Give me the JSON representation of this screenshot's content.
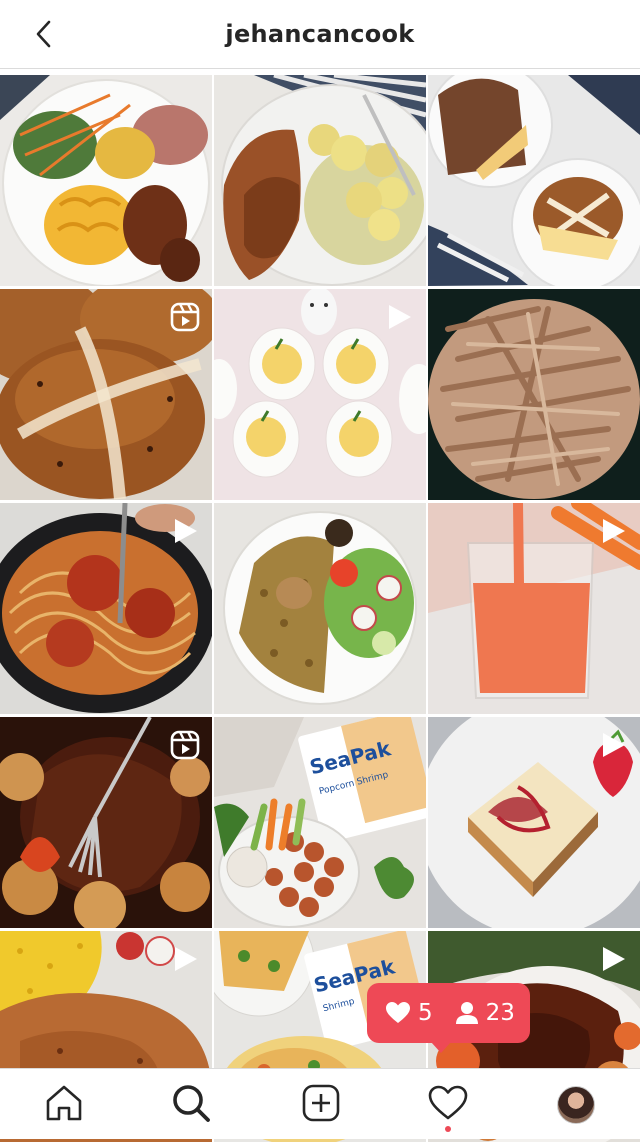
{
  "header": {
    "username": "jehancancook",
    "back_icon": "chevron-left-icon"
  },
  "grid": {
    "tiles": [
      {
        "name": "platter-mac-cheese-ham",
        "badge": "none"
      },
      {
        "name": "roast-chicken-dumplings",
        "badge": "none"
      },
      {
        "name": "fruit-bread-cheese",
        "badge": "none"
      },
      {
        "name": "hot-cross-buns",
        "badge": "reel"
      },
      {
        "name": "deviled-eggs",
        "badge": "video"
      },
      {
        "name": "veggie-fries",
        "badge": "none"
      },
      {
        "name": "spaghetti-meatballs",
        "badge": "video"
      },
      {
        "name": "rice-bowl-salad",
        "badge": "none"
      },
      {
        "name": "carrot-smoothie",
        "badge": "video"
      },
      {
        "name": "pot-roast",
        "badge": "reel"
      },
      {
        "name": "popcorn-shrimp-platter",
        "badge": "none"
      },
      {
        "name": "strawberry-cheesecake-bar",
        "badge": "video"
      },
      {
        "name": "roast-chicken-yellow-rice",
        "badge": "video"
      },
      {
        "name": "shrimp-pizza",
        "badge": "none"
      },
      {
        "name": "braised-beef",
        "badge": "video"
      }
    ],
    "package_text": {
      "brand": "SeaPak",
      "product": "Popcorn Shrimp",
      "product2": "Shrimp"
    }
  },
  "notification": {
    "likes": "5",
    "followers": "23",
    "color": "#ee4956"
  },
  "tabbar": {
    "tabs": [
      "home-icon",
      "search-icon",
      "new-post-icon",
      "activity-heart-icon",
      "profile-avatar"
    ]
  }
}
